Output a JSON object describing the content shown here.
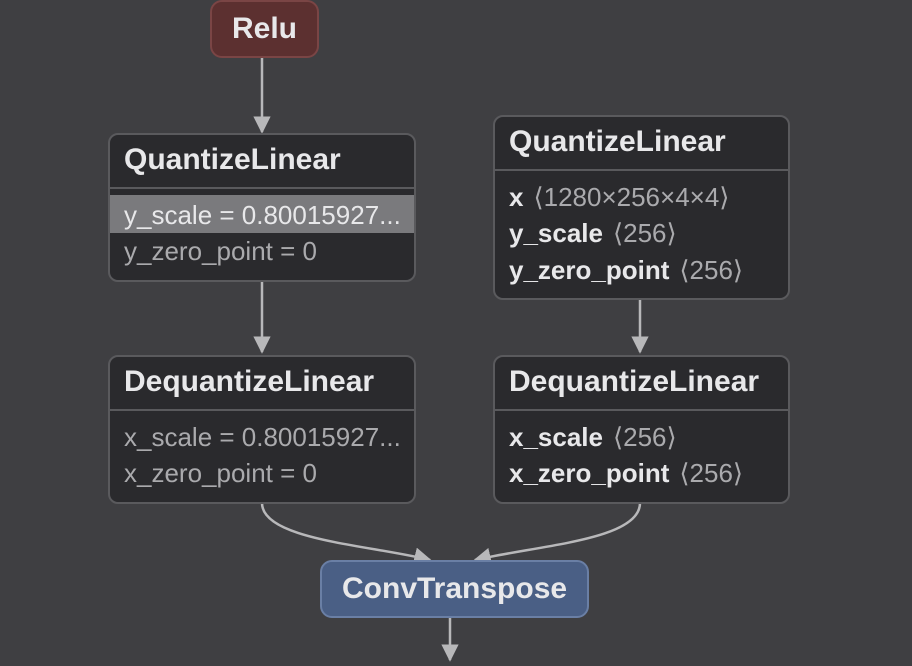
{
  "relu": {
    "label": "Relu"
  },
  "left_quant": {
    "title": "QuantizeLinear",
    "row1": "y_scale = 0.80015927...",
    "row2": "y_zero_point = 0"
  },
  "right_quant": {
    "title": "QuantizeLinear",
    "r1_name": "x",
    "r1_dim": "⟨1280×256×4×4⟩",
    "r2_name": "y_scale",
    "r2_dim": "⟨256⟩",
    "r3_name": "y_zero_point",
    "r3_dim": "⟨256⟩"
  },
  "left_dequant": {
    "title": "DequantizeLinear",
    "row1": "x_scale = 0.80015927...",
    "row2": "x_zero_point = 0"
  },
  "right_dequant": {
    "title": "DequantizeLinear",
    "r1_name": "x_scale",
    "r1_dim": "⟨256⟩",
    "r2_name": "x_zero_point",
    "r2_dim": "⟨256⟩"
  },
  "conv": {
    "label": "ConvTranspose"
  }
}
